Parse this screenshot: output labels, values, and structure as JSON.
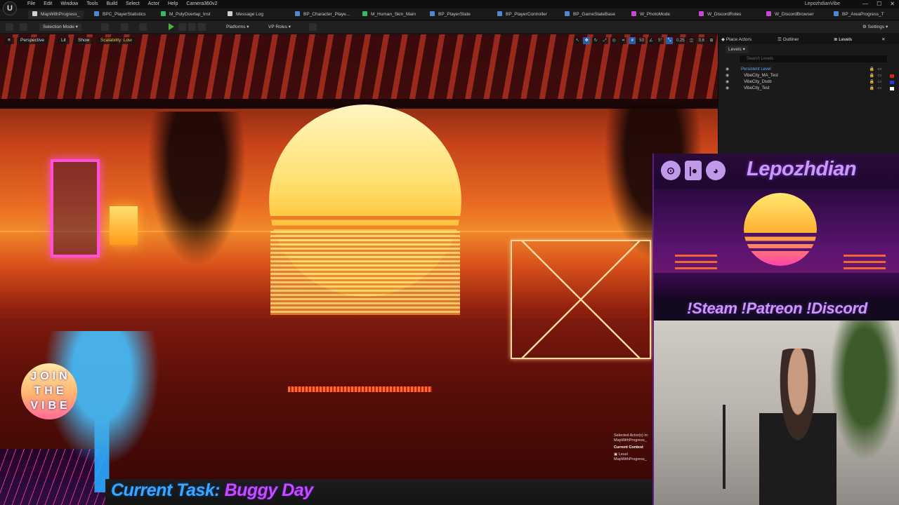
{
  "app": {
    "logo": "U",
    "project_name": "LepozhdianVibe",
    "menus": [
      "File",
      "Edit",
      "Window",
      "Tools",
      "Build",
      "Select",
      "Actor",
      "Help",
      "Camera360v2"
    ],
    "window_controls": [
      "—",
      "☐",
      "✕"
    ]
  },
  "tabs": [
    {
      "label": "MapWithProgress_",
      "icon": "map-icon",
      "color": "#d0d0d0",
      "active": true
    },
    {
      "label": "BPC_PlayerStatistics",
      "icon": "blueprint-icon",
      "color": "#4a8ad8"
    },
    {
      "label": "M_PolyOverlap_Inst",
      "icon": "material-icon",
      "color": "#3ab86a"
    },
    {
      "label": "Message Log",
      "icon": "log-icon",
      "color": "#cfcfcf"
    },
    {
      "label": "BP_Character_Playe...",
      "icon": "blueprint-icon",
      "color": "#4a8ad8"
    },
    {
      "label": "M_Human_Skin_Main",
      "icon": "material-icon",
      "color": "#3ab86a"
    },
    {
      "label": "BP_PlayerState",
      "icon": "blueprint-icon",
      "color": "#4a8ad8"
    },
    {
      "label": "BP_PlayerController",
      "icon": "blueprint-icon",
      "color": "#4a8ad8"
    },
    {
      "label": "BP_GameStateBase",
      "icon": "blueprint-icon",
      "color": "#4a8ad8"
    },
    {
      "label": "W_PhotoMode",
      "icon": "widget-icon",
      "color": "#c84ad8"
    },
    {
      "label": "W_DiscordRoles",
      "icon": "widget-icon",
      "color": "#c84ad8"
    },
    {
      "label": "W_DiscordBrowser",
      "icon": "widget-icon",
      "color": "#c84ad8"
    },
    {
      "label": "BP_AreaProgress_T",
      "icon": "blueprint-icon",
      "color": "#4a8ad8"
    }
  ],
  "toolbar": {
    "selection_mode": "Selection Mode",
    "platforms": "Platforms",
    "vp_roles": "VP Roles",
    "settings": "Settings"
  },
  "viewport": {
    "perspective": "Perspective",
    "lit": "Lit",
    "show": "Show",
    "scalability": "Scalability: Low",
    "grid_snap": "50",
    "rot_snap": "5°",
    "scale_snap": "0.25",
    "cam_speed": "0.6",
    "selected_actors": "Selected Actor(s) in:",
    "selected_map": "MapWithProgress_",
    "current_context": "Current Context",
    "context_type": "Level",
    "context_map": "MapWithProgress_"
  },
  "right_panel": {
    "tabs": [
      "Place Actors",
      "Outliner",
      "Levels"
    ],
    "levels_header": "Levels",
    "search_placeholder": "Search Levels",
    "levels": [
      {
        "name": "Persistent Level",
        "persistent": true,
        "color": ""
      },
      {
        "name": "VibeCity_MA_Test",
        "color": "#d82020"
      },
      {
        "name": "VibeCity_Dsob",
        "color": "#2a3ad8"
      },
      {
        "name": "VibeCity_Test",
        "color": "#ffffff"
      }
    ]
  },
  "overlay": {
    "brand_name": "Lepozhdian",
    "icons": [
      "steam-icon",
      "patreon-icon",
      "discord-icon"
    ],
    "cta": "!Steam !Patreon !Discord",
    "join_text": "JOIN THE VIBE",
    "task_label": "Current Task:",
    "task_value": "Buggy Day"
  }
}
